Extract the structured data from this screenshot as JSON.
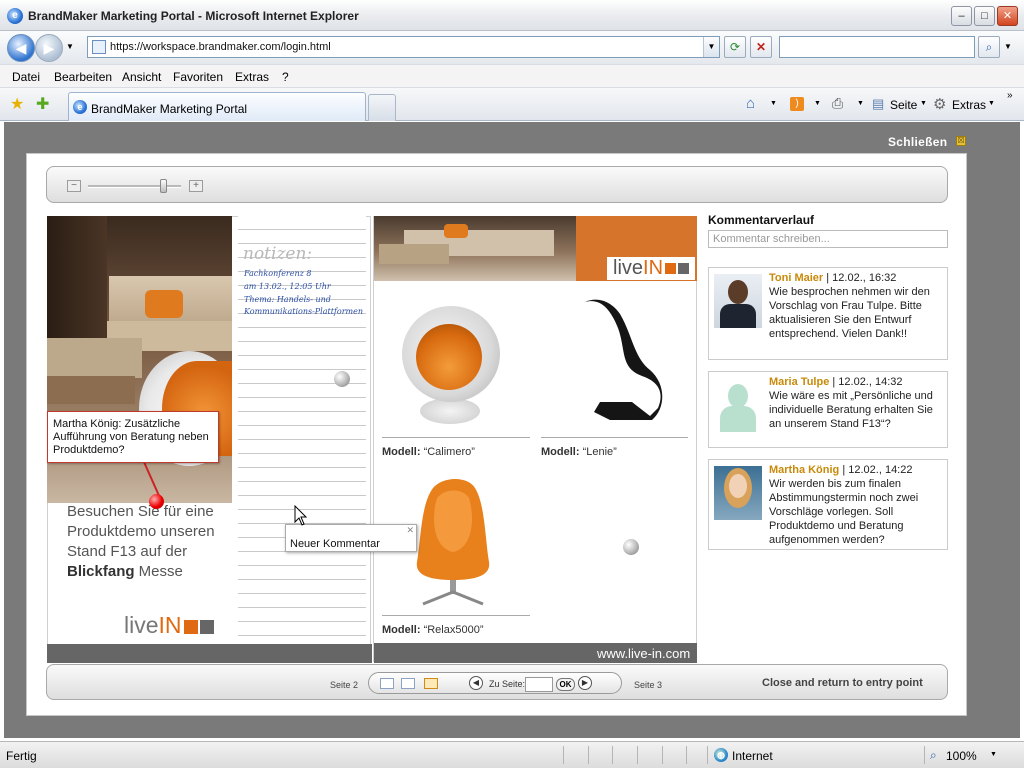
{
  "window": {
    "title": "BrandMaker Marketing Portal - Microsoft Internet Explorer",
    "minimize": "–",
    "maximize": "□",
    "close": "✕"
  },
  "addressbar": {
    "url": "https://workspace.brandmaker.com/login.html",
    "search_placeholder": ""
  },
  "menu": [
    "Datei",
    "Bearbeiten",
    "Ansicht",
    "Favoriten",
    "Extras",
    "?"
  ],
  "tabs": {
    "active_label": "BrandMaker Marketing Portal",
    "toolbar_seite": "Seite",
    "toolbar_extras": "Extras"
  },
  "viewer": {
    "close_label": "Schließen",
    "close_icon": "☒",
    "zoom_minus": "−",
    "zoom_plus": "+",
    "zoom_level": 0.82
  },
  "page2": {
    "notes_title": "notizen:",
    "notes_lines": [
      "Fachkonferenz 8",
      "am 13.02., 12:05 Uhr",
      "Thema: Handels- und",
      "Kommunikations-Plattformen"
    ],
    "slogan_lines": [
      "Besuchen Sie für eine",
      "Produktdemo unseren",
      "Stand F13 auf der"
    ],
    "slogan_bold": "Blickfang",
    "slogan_end": " Messe",
    "logo_live": "live",
    "logo_in": "IN",
    "sticky_comment": "Martha König: Zusätzliche Aufführung von Beratung neben Produktdemo?"
  },
  "page3": {
    "logo_live": "live",
    "logo_in": "IN",
    "url": "www.live-in.com",
    "products": [
      {
        "label": "Modell:",
        "name": "“Calimero”"
      },
      {
        "label": "Modell:",
        "name": "“Lenie”"
      },
      {
        "label": "Modell:",
        "name": "“Relax5000”"
      }
    ]
  },
  "pager": {
    "prev_page": "Seite 2",
    "next_page": "Seite 3",
    "goto_label": "Zu Seite:",
    "ok": "OK",
    "prev_icon": "◀",
    "next_icon": "▶",
    "close_return": "Close and return to entry point"
  },
  "comments": {
    "title": "Kommentarverlauf",
    "input_placeholder": "Kommentar schreiben...",
    "items": [
      {
        "author": "Toni Maier",
        "meta": " | 12.02., 16:32",
        "text": "Wie besprochen nehmen wir den Vorschlag von Frau Tulpe. Bitte aktualisieren Sie den Entwurf entsprechend. Vielen Dank!!"
      },
      {
        "author": "Maria Tulpe",
        "meta": " | 12.02., 14:32",
        "text": "Wie wäre es mit „Persönliche und individuelle Beratung erhalten Sie an unserem Stand F13“?"
      },
      {
        "author": "Martha König",
        "meta": " | 12.02., 14:22",
        "text": "Wir werden bis zum finalen Abstimmungstermin noch zwei Vorschläge vorlegen. Soll Produktdemo und Beratung aufgenommen werden?"
      }
    ]
  },
  "popup": {
    "label": "Neuer Kommentar",
    "close": "✕"
  },
  "status": {
    "left": "Fertig",
    "zone": "Internet",
    "zoom": "100%"
  }
}
